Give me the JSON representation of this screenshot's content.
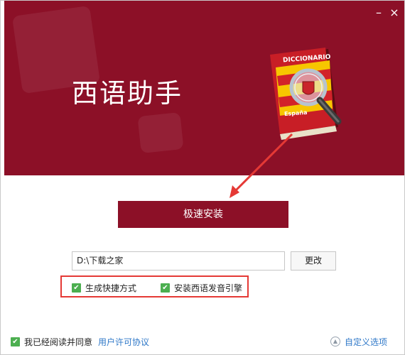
{
  "window": {
    "minimize_glyph": "–",
    "close_glyph": "×"
  },
  "banner": {
    "title": "西语助手",
    "color": "#8c1027"
  },
  "book": {
    "title": "DICCIONARIO",
    "subtitle": "España"
  },
  "install": {
    "label": "极速安装"
  },
  "path": {
    "value": "D:\\下载之家",
    "change_label": "更改"
  },
  "options": [
    {
      "label": "生成快捷方式",
      "checked": true
    },
    {
      "label": "安装西语发音引擎",
      "checked": true
    }
  ],
  "footer": {
    "agree_label": "我已经阅读并同意",
    "license_link": "用户许可协议",
    "custom_label": "自定义选项"
  },
  "colors": {
    "accent": "#8c1027",
    "check": "#4caf50",
    "highlight": "#e53935",
    "link": "#2f78c8"
  }
}
